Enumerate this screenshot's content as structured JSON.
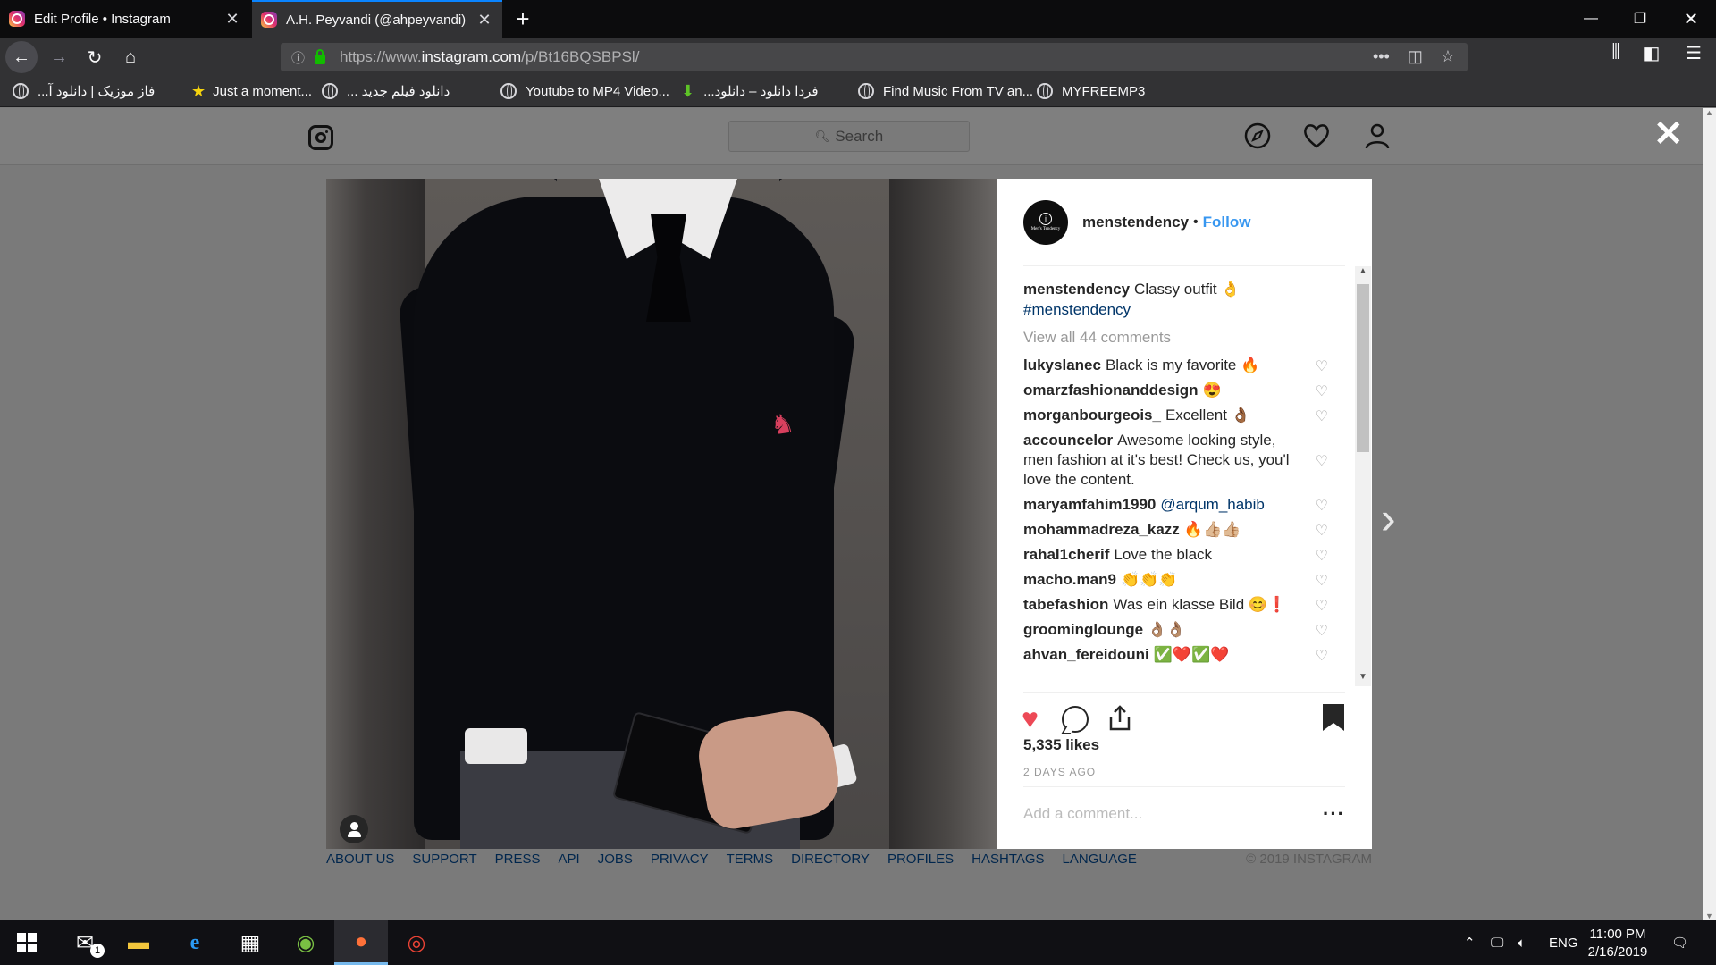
{
  "browser": {
    "tabs": [
      {
        "title": "Edit Profile • Instagram"
      },
      {
        "title": "A.H. Peyvandi (@ahpeyvandi) •"
      }
    ],
    "url_prefix": "https://www.",
    "url_domain": "instagram.com",
    "url_path": "/p/Bt16BQSBPSl/",
    "bookmarks": [
      {
        "label": "فاز موزیک | دانلود آ...",
        "icon": "globe-icon"
      },
      {
        "label": "Just a moment...",
        "icon": "star-icon"
      },
      {
        "label": "دانلود فیلم جدید ...",
        "icon": "globe-icon"
      },
      {
        "label": "Youtube to MP4 Video...",
        "icon": "globe-icon"
      },
      {
        "label": "فردا دانلود – دانلود...",
        "icon": "download-icon"
      },
      {
        "label": "Find Music From TV an...",
        "icon": "globe-icon"
      },
      {
        "label": "MYFREEMP3",
        "icon": "globe-icon"
      }
    ]
  },
  "instagram": {
    "search_placeholder": "Search",
    "post": {
      "username": "menstendency",
      "follow_label": "Follow",
      "avatar_text": "Men's Tendency",
      "caption_text": "Classy outfit 👌",
      "caption_tag": "#menstendency",
      "view_all": "View all 44 comments",
      "comments": [
        {
          "user": "lukyslanec",
          "text": "Black is my favorite 🔥"
        },
        {
          "user": "omarzfashionanddesign",
          "text": "😍"
        },
        {
          "user": "morganbourgeois_",
          "text": "Excellent 👌🏾"
        },
        {
          "user": "accouncelor",
          "text": "Awesome looking style, men fashion at it's best! Check us, you'l love the content."
        },
        {
          "user": "maryamfahim1990",
          "text": "@arqum_habib"
        },
        {
          "user": "mohammadreza_kazz",
          "text": "🔥👍🏼👍🏼"
        },
        {
          "user": "rahal1cherif",
          "text": "Love the black"
        },
        {
          "user": "macho.man9",
          "text": "👏👏👏"
        },
        {
          "user": "tabefashion",
          "text": "Was ein klasse Bild 😊❗"
        },
        {
          "user": "groominglounge",
          "text": "👌🏽👌🏽"
        },
        {
          "user": "ahvan_fereidouni",
          "text": "✅❤️✅❤️"
        }
      ],
      "likes": "5,335 likes",
      "timestamp": "2 DAYS AGO",
      "comment_placeholder": "Add a comment...",
      "liked": true,
      "saved": true
    },
    "footer_links": [
      "ABOUT US",
      "SUPPORT",
      "PRESS",
      "API",
      "JOBS",
      "PRIVACY",
      "TERMS",
      "DIRECTORY",
      "PROFILES",
      "HASHTAGS",
      "LANGUAGE"
    ],
    "copyright": "© 2019 INSTAGRAM"
  },
  "taskbar": {
    "mail_badge": "1",
    "language": "ENG",
    "time": "11:00 PM",
    "date": "2/16/2019"
  },
  "colors": {
    "accent_blue": "#3897f0",
    "like_red": "#ed4956",
    "firefox_tab_accent": "#0a84ff"
  }
}
